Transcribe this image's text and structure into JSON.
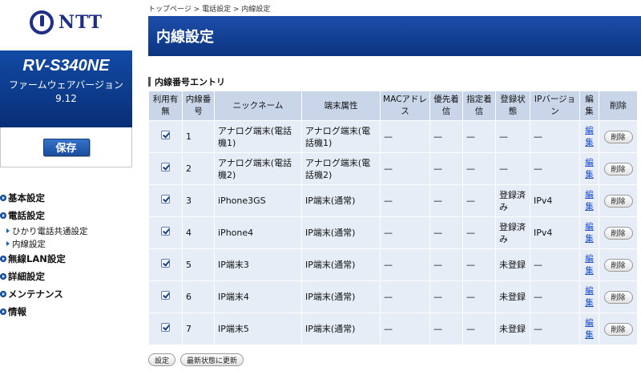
{
  "logo": {
    "text": "NTT"
  },
  "device": {
    "model": "RV-S340NE",
    "fw_label": "ファームウェアバージョン",
    "fw_version": "9.12"
  },
  "save_button": "保存",
  "menu": [
    {
      "label": "基本設定",
      "subs": []
    },
    {
      "label": "電話設定",
      "subs": [
        "ひかり電話共通設定",
        "内線設定"
      ]
    },
    {
      "label": "無線LAN設定",
      "subs": []
    },
    {
      "label": "詳細設定",
      "subs": []
    },
    {
      "label": "メンテナンス",
      "subs": []
    },
    {
      "label": "情報",
      "subs": []
    }
  ],
  "breadcrumb": "トップページ > 電話設定 > 内線設定",
  "page_title": "内線設定",
  "section_title": "内線番号エントリ",
  "columns": [
    "利用有無",
    "内線番号",
    "ニックネーム",
    "端末属性",
    "MACアドレス",
    "優先着信",
    "指定着信",
    "登録状態",
    "IPバージョン",
    "編集",
    "削除"
  ],
  "rows": [
    {
      "enabled": true,
      "number": "1",
      "nickname": "アナログ端末(電話機1)",
      "attr": "アナログ端末(電話機1)",
      "mac": "—",
      "priority": "—",
      "designated": "—",
      "status": "—",
      "ipver": "—",
      "edit": "編集",
      "delete": "削除"
    },
    {
      "enabled": true,
      "number": "2",
      "nickname": "アナログ端末(電話機2)",
      "attr": "アナログ端末(電話機2)",
      "mac": "—",
      "priority": "—",
      "designated": "—",
      "status": "—",
      "ipver": "—",
      "edit": "編集",
      "delete": "削除"
    },
    {
      "enabled": true,
      "number": "3",
      "nickname": "iPhone3GS",
      "attr": "IP端末(通常)",
      "mac": "—",
      "priority": "—",
      "designated": "—",
      "status": "登録済み",
      "ipver": "IPv4",
      "edit": "編集",
      "delete": "削除"
    },
    {
      "enabled": true,
      "number": "4",
      "nickname": "iPhone4",
      "attr": "IP端末(通常)",
      "mac": "—",
      "priority": "—",
      "designated": "—",
      "status": "登録済み",
      "ipver": "IPv4",
      "edit": "編集",
      "delete": "削除"
    },
    {
      "enabled": true,
      "number": "5",
      "nickname": "IP端末3",
      "attr": "IP端末(通常)",
      "mac": "—",
      "priority": "—",
      "designated": "—",
      "status": "未登録",
      "ipver": "—",
      "edit": "編集",
      "delete": "削除"
    },
    {
      "enabled": true,
      "number": "6",
      "nickname": "IP端末4",
      "attr": "IP端末(通常)",
      "mac": "—",
      "priority": "—",
      "designated": "—",
      "status": "未登録",
      "ipver": "—",
      "edit": "編集",
      "delete": "削除"
    },
    {
      "enabled": true,
      "number": "7",
      "nickname": "IP端末5",
      "attr": "IP端末(通常)",
      "mac": "—",
      "priority": "—",
      "designated": "—",
      "status": "未登録",
      "ipver": "—",
      "edit": "編集",
      "delete": "削除"
    }
  ],
  "buttons": {
    "set": "設定",
    "refresh": "最新状態に更新"
  },
  "colors": {
    "brand_blue": "#1f2f86",
    "header_blue": "#0c3580",
    "table_header": "#c9d6e9",
    "table_cell": "#e6edf7",
    "link": "#1a4dcc"
  }
}
